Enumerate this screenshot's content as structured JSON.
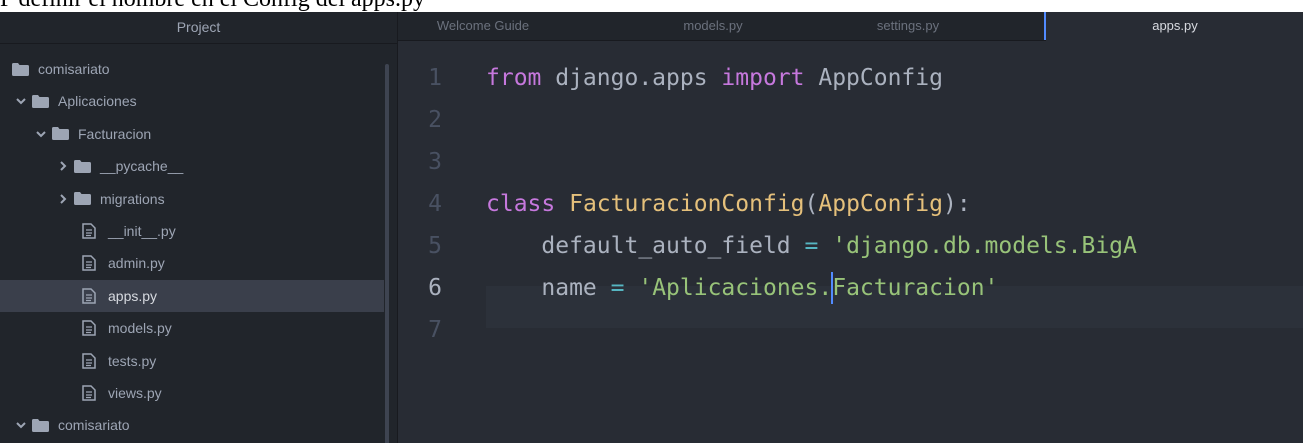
{
  "caption": "P definir el nombre en el Config del apps.py",
  "sidebar": {
    "title": "Project",
    "items": [
      {
        "label": "comisariato",
        "kind": "folder",
        "depth": 0,
        "expanded": null
      },
      {
        "label": "Aplicaciones",
        "kind": "folder",
        "depth": 1,
        "expanded": true
      },
      {
        "label": "Facturacion",
        "kind": "folder",
        "depth": 2,
        "expanded": true
      },
      {
        "label": "__pycache__",
        "kind": "folder",
        "depth": 3,
        "expanded": false
      },
      {
        "label": "migrations",
        "kind": "folder",
        "depth": 3,
        "expanded": false
      },
      {
        "label": "__init__.py",
        "kind": "file",
        "depth": 3
      },
      {
        "label": "admin.py",
        "kind": "file",
        "depth": 3
      },
      {
        "label": "apps.py",
        "kind": "file",
        "depth": 3,
        "selected": true
      },
      {
        "label": "models.py",
        "kind": "file",
        "depth": 3
      },
      {
        "label": "tests.py",
        "kind": "file",
        "depth": 3
      },
      {
        "label": "views.py",
        "kind": "file",
        "depth": 3
      },
      {
        "label": "comisariato",
        "kind": "folder",
        "depth": 1,
        "expanded": true
      }
    ]
  },
  "tabs": [
    {
      "label": "Welcome Guide",
      "active": false
    },
    {
      "label": "models.py",
      "active": false
    },
    {
      "label": "settings.py",
      "active": false
    },
    {
      "label": "apps.py",
      "active": true
    }
  ],
  "editor": {
    "line_numbers": [
      "1",
      "2",
      "3",
      "4",
      "5",
      "6",
      "7"
    ],
    "current_line": 6,
    "lines": [
      [
        {
          "t": "from",
          "c": "kw"
        },
        {
          "t": " django.apps ",
          "c": "pl"
        },
        {
          "t": "import",
          "c": "kw"
        },
        {
          "t": " AppConfig",
          "c": "pl"
        }
      ],
      [],
      [],
      [
        {
          "t": "class",
          "c": "kw"
        },
        {
          "t": " ",
          "c": "pl"
        },
        {
          "t": "FacturacionConfig",
          "c": "cls"
        },
        {
          "t": "(",
          "c": "pl"
        },
        {
          "t": "AppConfig",
          "c": "cls"
        },
        {
          "t": "):",
          "c": "pl"
        }
      ],
      [
        {
          "t": "    default_auto_field ",
          "c": "pl"
        },
        {
          "t": "=",
          "c": "op"
        },
        {
          "t": " ",
          "c": "pl"
        },
        {
          "t": "'django.db.models.BigA",
          "c": "str"
        }
      ],
      [
        {
          "t": "    name ",
          "c": "pl"
        },
        {
          "t": "=",
          "c": "op"
        },
        {
          "t": " ",
          "c": "pl"
        },
        {
          "t": "'Aplicaciones.",
          "c": "str"
        },
        {
          "t": "",
          "c": "caret"
        },
        {
          "t": "Facturacion'",
          "c": "str"
        }
      ],
      []
    ]
  },
  "colors": {
    "background": "#21252b",
    "editor_bg": "#282c34",
    "selection": "#3a3f4b",
    "keyword": "#c678dd",
    "class": "#e5c07b",
    "string": "#98c379",
    "operator": "#56b6c2",
    "caret": "#528bff"
  },
  "icons": {
    "folder": "folder-icon",
    "file": "file-text-icon",
    "expanded": "chevron-down-icon",
    "collapsed": "chevron-right-icon"
  }
}
